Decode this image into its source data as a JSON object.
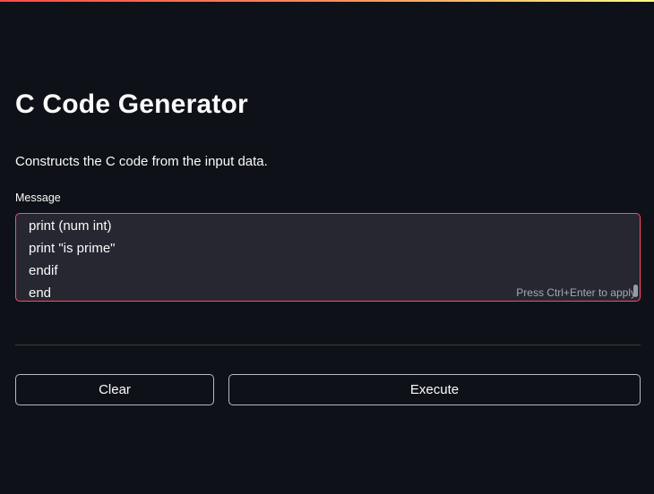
{
  "page": {
    "title": "C Code Generator",
    "description": "Constructs the C code from the input data."
  },
  "message_field": {
    "label": "Message",
    "visible_lines": [
      "print (num int)",
      "print \"is prime\"",
      "endif",
      "end"
    ],
    "hint": "Press Ctrl+Enter to apply"
  },
  "actions": {
    "clear_label": "Clear",
    "execute_label": "Execute"
  },
  "colors": {
    "background": "#0e1117",
    "input_background": "#262730",
    "focus_border": "#ff4b6e",
    "text": "#fafafa"
  }
}
